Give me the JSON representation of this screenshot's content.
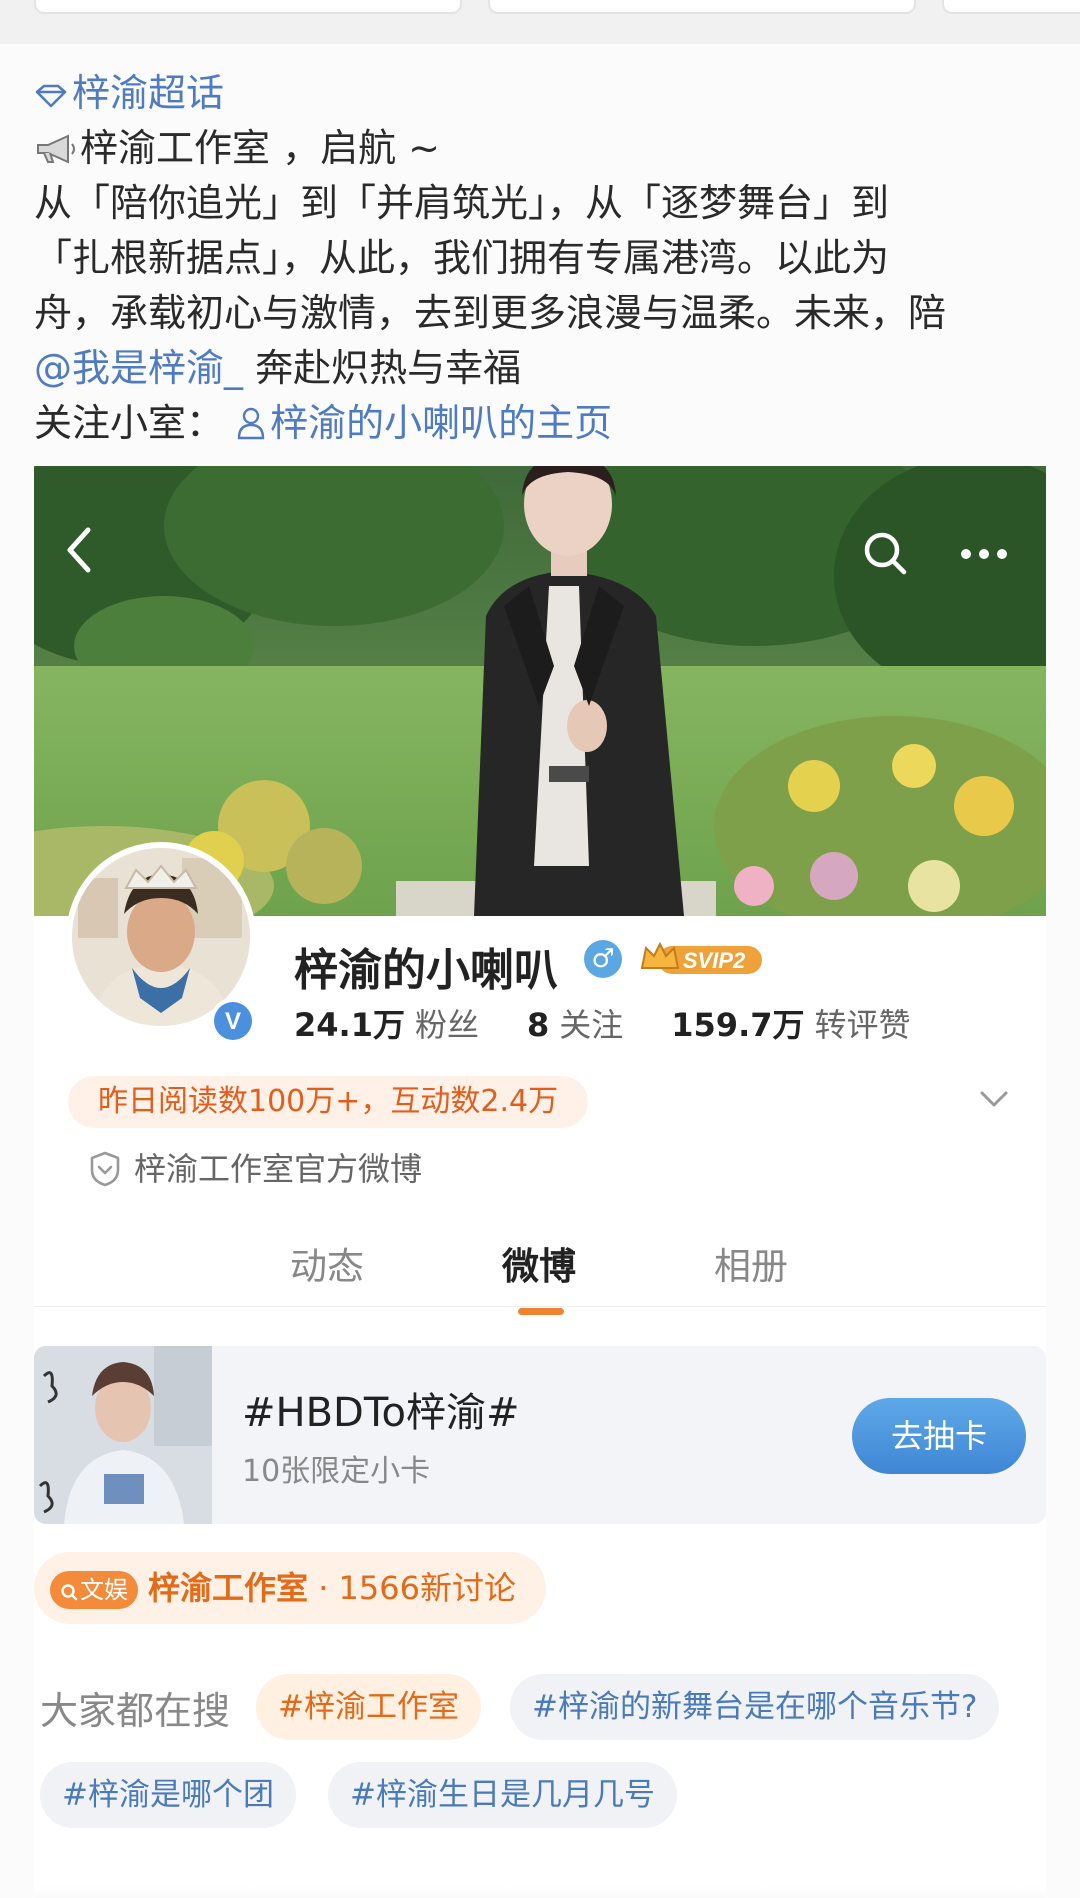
{
  "post": {
    "topic": "梓渝超话",
    "headline": "梓渝工作室 ，启航 ~",
    "body_line1": "从「陪你追光」到「并肩筑光」，从「逐梦舞台」到",
    "body_line2": "「扎根新据点」，从此，我们拥有专属港湾。以此为",
    "body_line3": "舟，承载初心与激情，去到更多浪漫与温柔。未来，陪",
    "mention": "@我是梓渝_",
    "mention_tail": " 奔赴炽热与幸福",
    "follow_label": "关注小室：",
    "follow_link": "梓渝的小喇叭的主页"
  },
  "profile": {
    "name": "梓渝的小喇叭",
    "gender_symbol": "♂",
    "vip_label": "SVIP2",
    "followers_value": "24.1万",
    "followers_label": "粉丝",
    "following_value": "8",
    "following_label": "关注",
    "likes_value": "159.7万",
    "likes_label": "转评赞",
    "read_stats": "昨日阅读数100万+，互动数2.4万",
    "official_desc": "梓渝工作室官方微博",
    "verified_mark": "V"
  },
  "tabs": {
    "activity": "动态",
    "weibo": "微博",
    "album": "相册"
  },
  "promo": {
    "title": "#HBDTo梓渝#",
    "subtitle": "10张限定小卡",
    "button": "去抽卡"
  },
  "topic_pill": {
    "tag": "文娱",
    "name": "梓渝工作室",
    "count": " · 1566新讨论"
  },
  "search": {
    "label": "大家都在搜",
    "chips": [
      "#梓渝工作室",
      "#梓渝的新舞台是在哪个音乐节?",
      "#梓渝是哪个团",
      "#梓渝生日是几月几号"
    ]
  },
  "colors": {
    "link": "#4f7bc2",
    "accent_orange": "#f08232",
    "button_blue": "#4a90dc"
  }
}
